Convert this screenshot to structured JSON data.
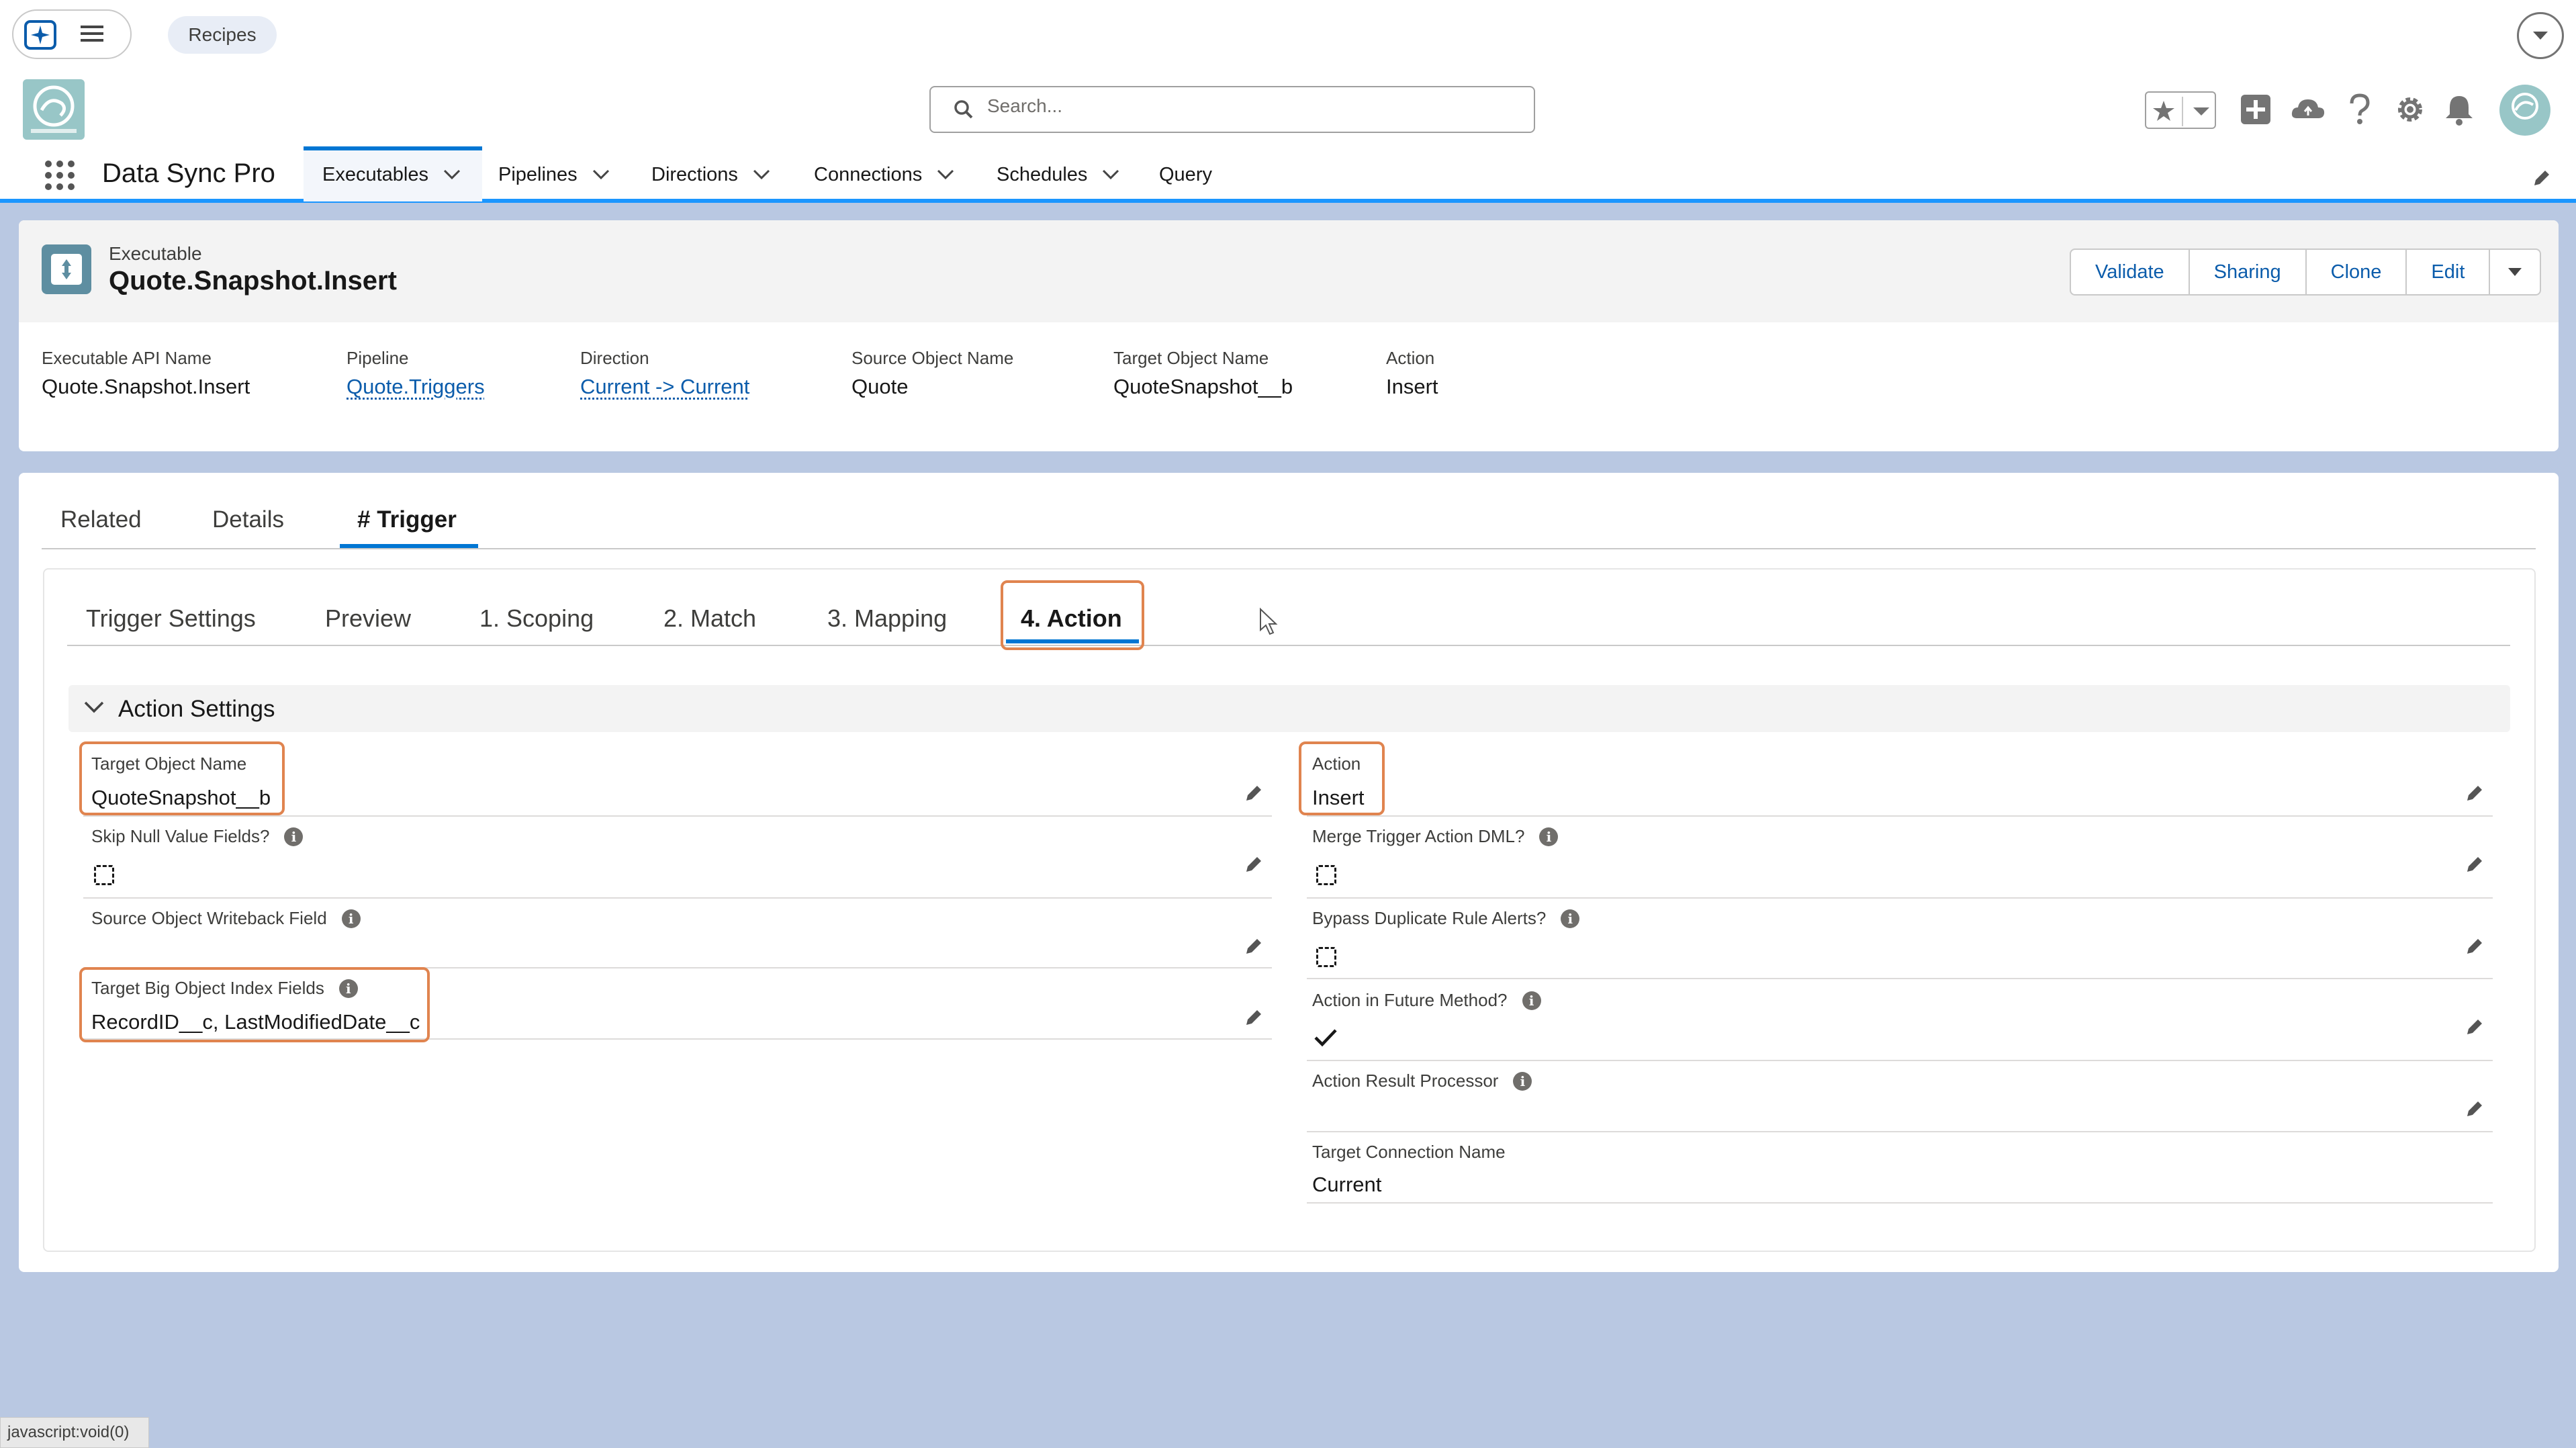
{
  "utility_bar": {
    "tab_label": "Recipes"
  },
  "header": {
    "search_placeholder": "Search..."
  },
  "nav": {
    "app_name": "Data Sync Pro",
    "items": [
      {
        "label": "Executables",
        "has_menu": true,
        "active": true
      },
      {
        "label": "Pipelines",
        "has_menu": true
      },
      {
        "label": "Directions",
        "has_menu": true
      },
      {
        "label": "Connections",
        "has_menu": true
      },
      {
        "label": "Schedules",
        "has_menu": true
      },
      {
        "label": "Query",
        "has_menu": false
      }
    ]
  },
  "record": {
    "type": "Executable",
    "title": "Quote.Snapshot.Insert",
    "actions": [
      "Validate",
      "Sharing",
      "Clone",
      "Edit"
    ],
    "highlights": [
      {
        "label": "Executable API Name",
        "value": "Quote.Snapshot.Insert",
        "link": false
      },
      {
        "label": "Pipeline",
        "value": "Quote.Triggers",
        "link": true
      },
      {
        "label": "Direction",
        "value": "Current -> Current",
        "link": true
      },
      {
        "label": "Source Object Name",
        "value": "Quote",
        "link": false
      },
      {
        "label": "Target Object Name",
        "value": "QuoteSnapshot__b",
        "link": false
      },
      {
        "label": "Action",
        "value": "Insert",
        "link": false
      }
    ]
  },
  "tabs": [
    "Related",
    "Details",
    "# Trigger"
  ],
  "subtabs": [
    "Trigger Settings",
    "Preview",
    "1. Scoping",
    "2. Match",
    "3. Mapping",
    "4. Action"
  ],
  "section": {
    "title": "Action Settings",
    "left_fields": {
      "target_object_name": {
        "label": "Target Object Name",
        "value": "QuoteSnapshot__b"
      },
      "skip_null": {
        "label": "Skip Null Value Fields?",
        "checked": false
      },
      "writeback": {
        "label": "Source Object Writeback Field",
        "value": ""
      },
      "index_fields": {
        "label": "Target Big Object Index Fields",
        "value": "RecordID__c, LastModifiedDate__c"
      }
    },
    "right_fields": {
      "action": {
        "label": "Action",
        "value": "Insert"
      },
      "merge_dml": {
        "label": "Merge Trigger Action DML?",
        "checked": false
      },
      "bypass_dup": {
        "label": "Bypass Duplicate Rule Alerts?",
        "checked": false
      },
      "future_method": {
        "label": "Action in Future Method?",
        "checked": true
      },
      "result_processor": {
        "label": "Action Result Processor",
        "value": ""
      },
      "target_connection": {
        "label": "Target Connection Name",
        "value": "Current"
      }
    }
  },
  "status_bar": {
    "text": "javascript:void(0)"
  },
  "colors": {
    "brand": "#0176d3",
    "link": "#0b5cab",
    "highlight": "#e0844f",
    "background": "#b9c8e2"
  },
  "icons": [
    "sparkle-icon",
    "menu-icon",
    "chevron-down-icon",
    "search-icon",
    "star-icon",
    "add-icon",
    "cloud-icon",
    "help-icon",
    "gear-icon",
    "bell-icon",
    "avatar",
    "waffle-icon",
    "pencil-icon",
    "info-icon",
    "check-icon",
    "cursor-icon"
  ]
}
